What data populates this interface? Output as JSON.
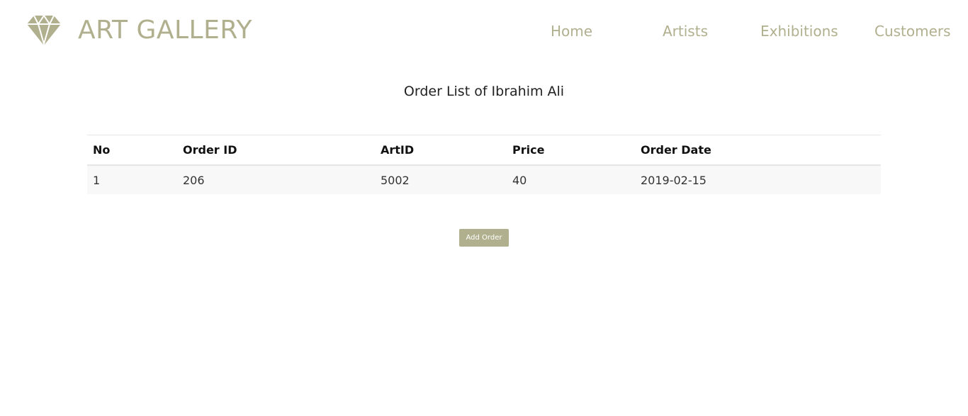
{
  "brand": {
    "title": "ART GALLERY",
    "logo_icon": "diamond-icon",
    "color": "#b1b08e"
  },
  "nav": {
    "items": [
      {
        "label": "Home"
      },
      {
        "label": "Artists"
      },
      {
        "label": "Exhibitions"
      },
      {
        "label": "Customers"
      }
    ]
  },
  "page": {
    "title": "Order List of Ibrahim Ali"
  },
  "table": {
    "columns": [
      "No",
      "Order ID",
      "ArtID",
      "Price",
      "Order Date"
    ],
    "rows": [
      [
        "1",
        "206",
        "5002",
        "40",
        "2019-02-15"
      ]
    ]
  },
  "actions": {
    "add_order_label": "Add Order"
  }
}
